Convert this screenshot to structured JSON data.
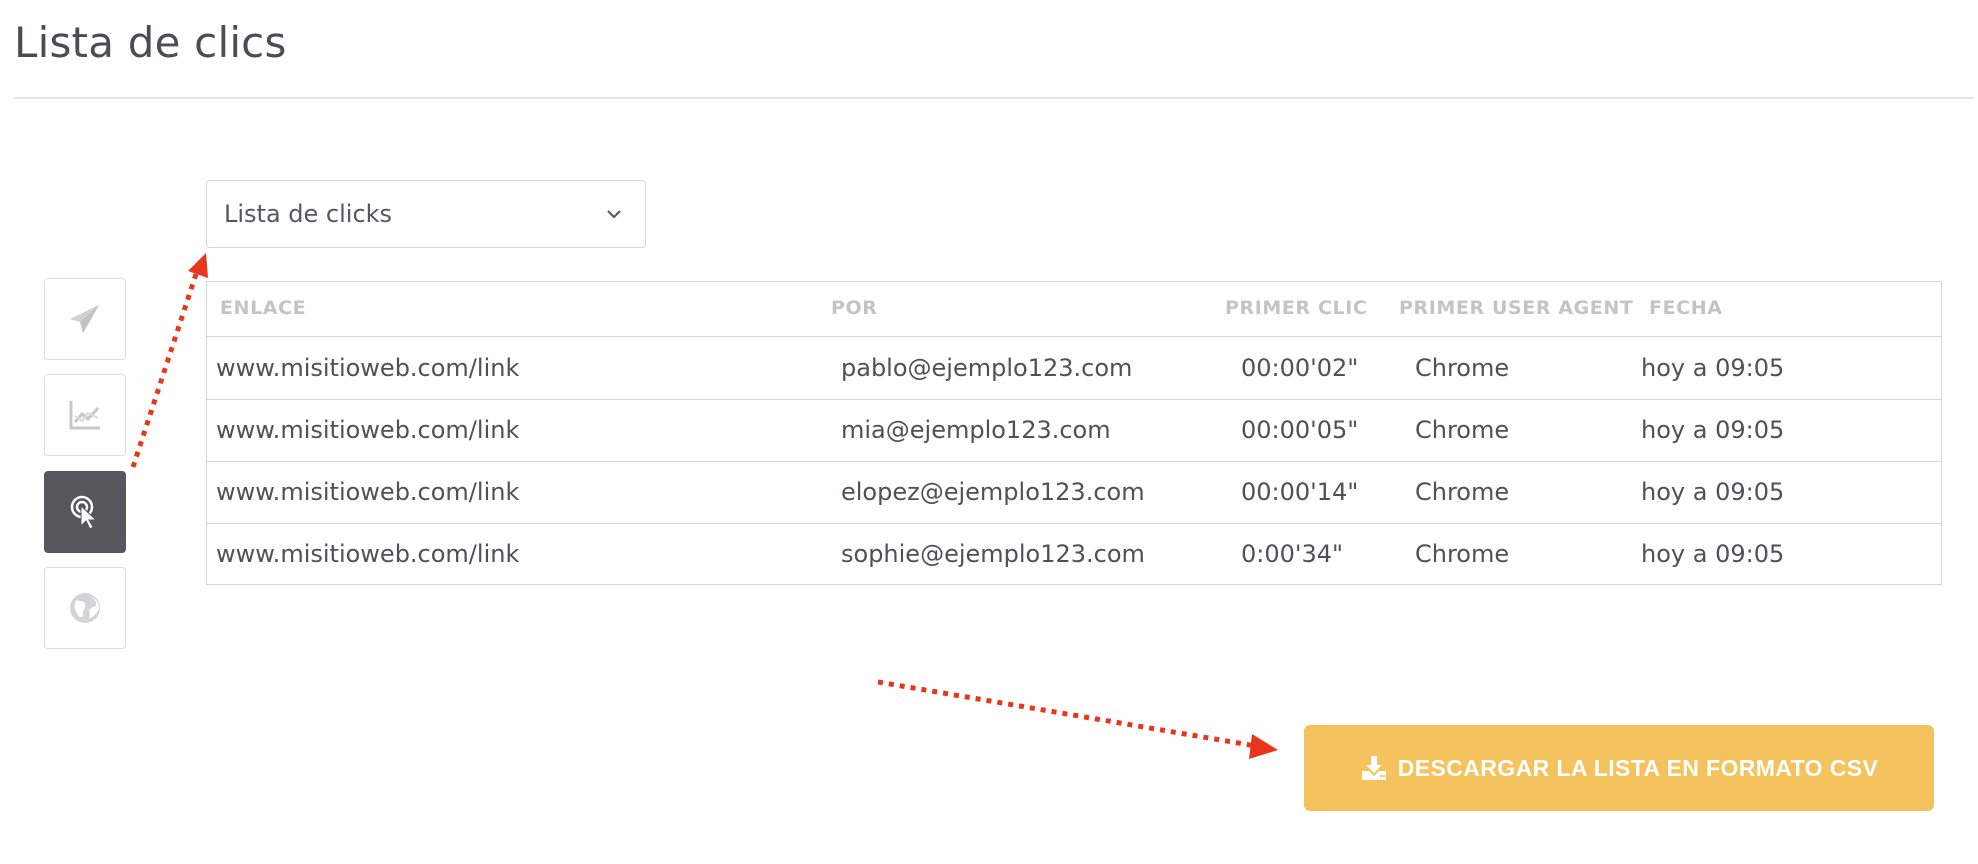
{
  "page": {
    "title": "Lista de clics"
  },
  "dropdown": {
    "selected": "Lista de clicks"
  },
  "sidebar": {
    "items": [
      {
        "icon": "send-icon",
        "active": false
      },
      {
        "icon": "chart-icon",
        "active": false
      },
      {
        "icon": "click-icon",
        "active": true
      },
      {
        "icon": "globe-icon",
        "active": false
      }
    ]
  },
  "table": {
    "headers": [
      "ENLACE",
      "POR",
      "PRIMER CLIC",
      "PRIMER USER AGENT",
      "FECHA"
    ],
    "rows": [
      [
        "www.misitioweb.com/link",
        "pablo@ejemplo123.com",
        "00:00'02\"",
        "Chrome",
        "hoy a 09:05"
      ],
      [
        "www.misitioweb.com/link",
        "mia@ejemplo123.com",
        "00:00'05\"",
        "Chrome",
        "hoy a 09:05"
      ],
      [
        "www.misitioweb.com/link",
        "elopez@ejemplo123.com",
        "00:00'14\"",
        "Chrome",
        "hoy a 09:05"
      ],
      [
        "www.misitioweb.com/link",
        "sophie@ejemplo123.com",
        "0:00'34\"",
        "Chrome",
        "hoy a 09:05"
      ]
    ]
  },
  "csv_button": {
    "label": "DESCARGAR LA LISTA EN FORMATO CSV"
  },
  "colors": {
    "accent": "#f4c35e",
    "active_sidebar": "#56575d",
    "annotation_arrow": "#e8361d"
  }
}
